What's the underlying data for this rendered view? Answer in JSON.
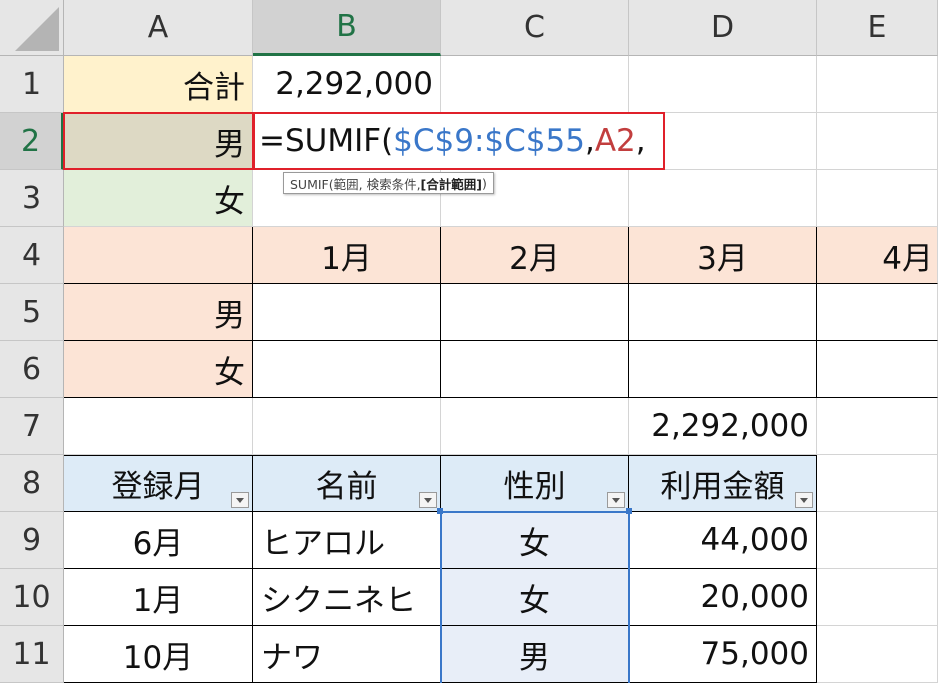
{
  "columns": [
    "A",
    "B",
    "C",
    "D",
    "E"
  ],
  "rows": [
    "1",
    "2",
    "3",
    "4",
    "5",
    "6",
    "7",
    "8",
    "9",
    "10",
    "11"
  ],
  "cells": {
    "A1": "合計",
    "B1": "2,292,000",
    "A2": "男",
    "A3": "女",
    "B4": "1月",
    "C4": "2月",
    "D4": "3月",
    "E4": "4月",
    "A5": "男",
    "A6": "女",
    "D7": "2,292,000",
    "A8": "登録月",
    "B8": "名前",
    "C8": "性別",
    "D8": "利用金額",
    "A9": "6月",
    "B9": "ヒアロル",
    "C9": "女",
    "D9": "44,000",
    "A10": "1月",
    "B10": "シクニネヒ",
    "C10": "女",
    "D10": "20,000",
    "A11": "10月",
    "B11": "ナワ",
    "C11": "男",
    "D11": "75,000"
  },
  "formula": {
    "eq_fn": "=SUMIF(",
    "range_ref": "$C$9:$C$55",
    "comma1": ",",
    "crit_ref": "A2",
    "comma2": ","
  },
  "tooltip": {
    "prefix": "SUMIF(範囲, 検索条件, ",
    "bold": "[合計範囲]",
    "suffix": ")"
  },
  "colors": {
    "sum_label_fill": "#fff2cc",
    "male_label_fill": "#ddd9c4",
    "female_label_fill": "#e2efda",
    "month_row_fill": "#fce4d6",
    "table_header_fill": "#ddebf7",
    "range_highlight_fill": "#e8eef8",
    "formula_range": "#3a77c9",
    "formula_ref": "#c23e3e",
    "edit_border": "#e0202a"
  }
}
